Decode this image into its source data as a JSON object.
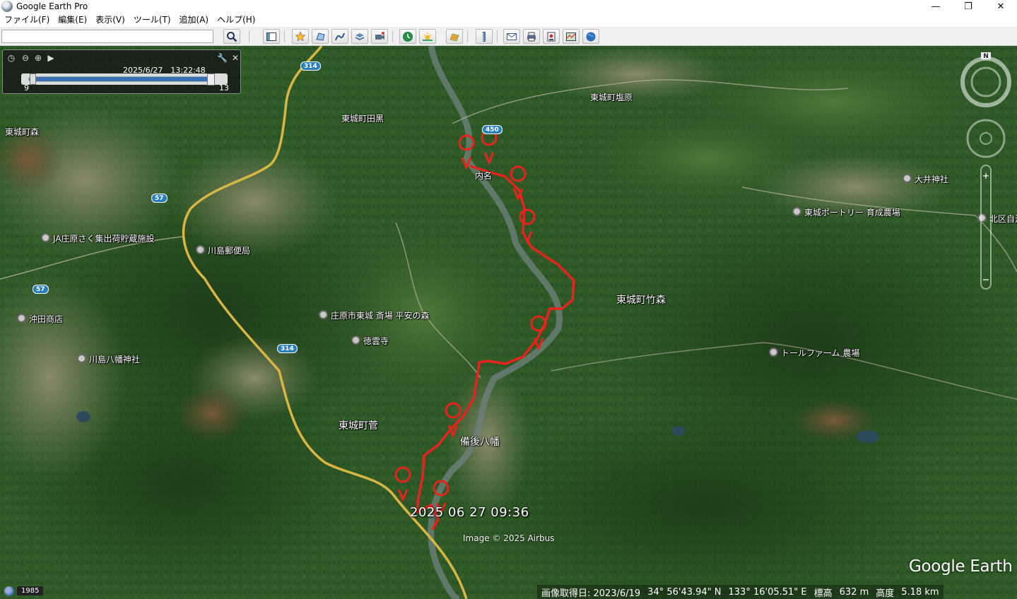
{
  "window": {
    "title": "Google Earth Pro",
    "minimize": "—",
    "maximize": "❐",
    "close": "✕"
  },
  "menu": [
    {
      "label": "ファイル(F)"
    },
    {
      "label": "編集(E)"
    },
    {
      "label": "表示(V)"
    },
    {
      "label": "ツール(T)"
    },
    {
      "label": "追加(A)"
    },
    {
      "label": "ヘルプ(H)"
    }
  ],
  "search": {
    "value": "",
    "placeholder": ""
  },
  "toolbar": {
    "buttons": [
      "search-icon",
      "sidebar-icon",
      "placemark-icon",
      "polygon-icon",
      "path-icon",
      "overlay-icon",
      "tour-icon",
      "historical-imagery-icon",
      "sun-icon",
      "planets-icon",
      "ruler-icon",
      "email-icon",
      "print-icon",
      "save-image-icon",
      "maps-icon",
      "earth-icon"
    ]
  },
  "time_slider": {
    "current": "2025/6/27　13:22:48",
    "range_min": "9",
    "range_max": "13"
  },
  "map_labels": [
    {
      "id": "tojo-mori",
      "text": "東城町森"
    },
    {
      "id": "tojo-taguri",
      "text": "東城町田黒"
    },
    {
      "id": "tojo-shiobara",
      "text": "東城町塩原"
    },
    {
      "id": "uchina",
      "text": "内名"
    },
    {
      "id": "oi-jinja",
      "text": "大井神社"
    },
    {
      "id": "ja-shobara",
      "text": "JA庄原さく集出荷貯蔵施設"
    },
    {
      "id": "kawashima-post",
      "text": "川島郵便局"
    },
    {
      "id": "tojo-poultry",
      "text": "東城ポートリー 育成農場"
    },
    {
      "id": "kitaku",
      "text": "北区自治"
    },
    {
      "id": "okita-shoten",
      "text": "沖田商店"
    },
    {
      "id": "heian-no-mori",
      "text": "庄原市東城 斎場 平安の森"
    },
    {
      "id": "tojo-takemori",
      "text": "東城町竹森"
    },
    {
      "id": "tokuunji",
      "text": "徳雲寺"
    },
    {
      "id": "kawashima-hachiman",
      "text": "川島八幡神社"
    },
    {
      "id": "toll-farm",
      "text": "トールファーム 農場"
    },
    {
      "id": "tojo-suge",
      "text": "東城町菅"
    },
    {
      "id": "bingo-yawata",
      "text": "備後八幡"
    }
  ],
  "route_shields": [
    "314",
    "450",
    "57",
    "57",
    "314"
  ],
  "overlay": {
    "timestamp": "2025 06 27 09:36",
    "credit": "Image © 2025 Airbus",
    "logo": "Google Earth",
    "year": "1985"
  },
  "status": {
    "imagery_date": "画像取得日: 2023/6/19",
    "lat": "34° 56'43.94\" N",
    "lon": "133° 16'05.51\" E",
    "elev_label": "標高",
    "elev_value": "632 m",
    "eye_label": "高度",
    "eye_value": "5.18 km"
  },
  "colors": {
    "track": "#e8231c",
    "shield": "#2b7fb8",
    "road": "#d9b544"
  }
}
